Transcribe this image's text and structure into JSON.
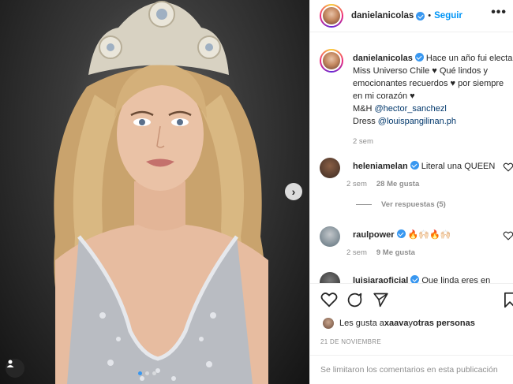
{
  "post": {
    "username": "danielanicolas",
    "follow_label": "Seguir",
    "more_label": "•••"
  },
  "caption": {
    "username": "danielanicolas",
    "line1": "Hace un año fui electa",
    "line2": "Miss Universo Chile ♥ Qué lindos y",
    "line3": "emocionantes recuerdos ♥ por siempre",
    "line4": "en mi corazón ♥",
    "mh_prefix": "M&H ",
    "mh_mention": "@hector_sanchezl",
    "dress_prefix": "Dress ",
    "dress_mention": "@louispangilinan.ph",
    "time": "2 sem"
  },
  "comments": [
    {
      "username": "heleniamelan",
      "text": "Literal una QUEEN",
      "time": "2 sem",
      "likes": "28 Me gusta",
      "avatar_color": "#3b2a22"
    },
    {
      "username": "raulpower",
      "text": "🔥🙌🏻🔥🙌🏻",
      "time": "2 sem",
      "likes": "9 Me gusta",
      "avatar_color": "#5c6f7a"
    },
    {
      "username": "luisjaraoficial",
      "text": "Que linda eres en",
      "avatar_color": "#2a2a2a"
    }
  ],
  "replies_label": "Ver respuestas (5)",
  "likes_summary": {
    "prefix": "Les gusta a ",
    "user": "xaava",
    "middle": " y ",
    "others": "otras personas"
  },
  "date": "21 DE NOVIEMBRE",
  "comments_limited": "Se limitaron los comentarios en esta publicación",
  "icons": [
    "heart-icon",
    "comment-icon",
    "share-icon",
    "bookmark-icon",
    "chevron-right-icon",
    "user-tag-icon",
    "more-icon"
  ],
  "colors": {
    "accent": "#0095f6",
    "verified": "#3897f0",
    "muted": "#8e8e8e",
    "mention": "#00376b"
  }
}
